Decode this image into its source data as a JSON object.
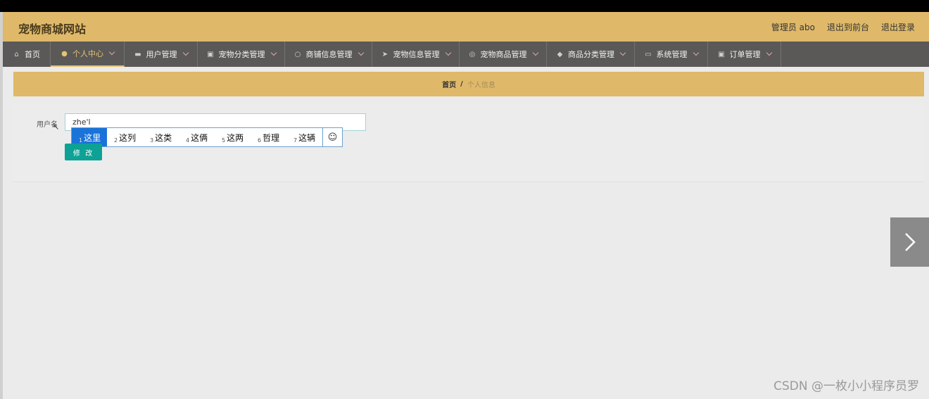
{
  "header": {
    "site_title": "宠物商城网站",
    "admin_label": "管理员 abo",
    "back_to_front": "退出到前台",
    "logout": "退出登录"
  },
  "nav": {
    "items": [
      {
        "label": "首页",
        "icon": "home-icon",
        "has_caret": false
      },
      {
        "label": "个人中心",
        "icon": "user-icon",
        "has_caret": true,
        "active": true
      },
      {
        "label": "用户管理",
        "icon": "briefcase-icon",
        "has_caret": true
      },
      {
        "label": "宠物分类管理",
        "icon": "clipboard-icon",
        "has_caret": true
      },
      {
        "label": "商铺信息管理",
        "icon": "power-icon",
        "has_caret": true
      },
      {
        "label": "宠物信息管理",
        "icon": "send-icon",
        "has_caret": true
      },
      {
        "label": "宠物商品管理",
        "icon": "circle-icon",
        "has_caret": true
      },
      {
        "label": "商品分类管理",
        "icon": "tag-icon",
        "has_caret": true
      },
      {
        "label": "系统管理",
        "icon": "monitor-icon",
        "has_caret": true
      },
      {
        "label": "订单管理",
        "icon": "clipboard-icon",
        "has_caret": true
      }
    ]
  },
  "breadcrumb": {
    "home": "首页",
    "separator": "/",
    "current": "个人信息"
  },
  "form": {
    "username_label": "用户名",
    "username_value": "zhe'l",
    "submit_label": "修 改"
  },
  "ime": {
    "candidates": [
      {
        "num": "1",
        "text": "这里",
        "selected": true
      },
      {
        "num": "2",
        "text": "这列"
      },
      {
        "num": "3",
        "text": "这类"
      },
      {
        "num": "4",
        "text": "这俩"
      },
      {
        "num": "5",
        "text": "这两"
      },
      {
        "num": "6",
        "text": "哲理"
      },
      {
        "num": "7",
        "text": "这辆"
      }
    ],
    "emoji_glyph": "☺"
  },
  "watermark": "CSDN @一枚小小程序员罗",
  "colors": {
    "header_bg": "#dfb969",
    "nav_bg": "#5a5958",
    "accent": "#e6c275",
    "button": "#0da295",
    "ime_selected": "#1a73d9"
  }
}
